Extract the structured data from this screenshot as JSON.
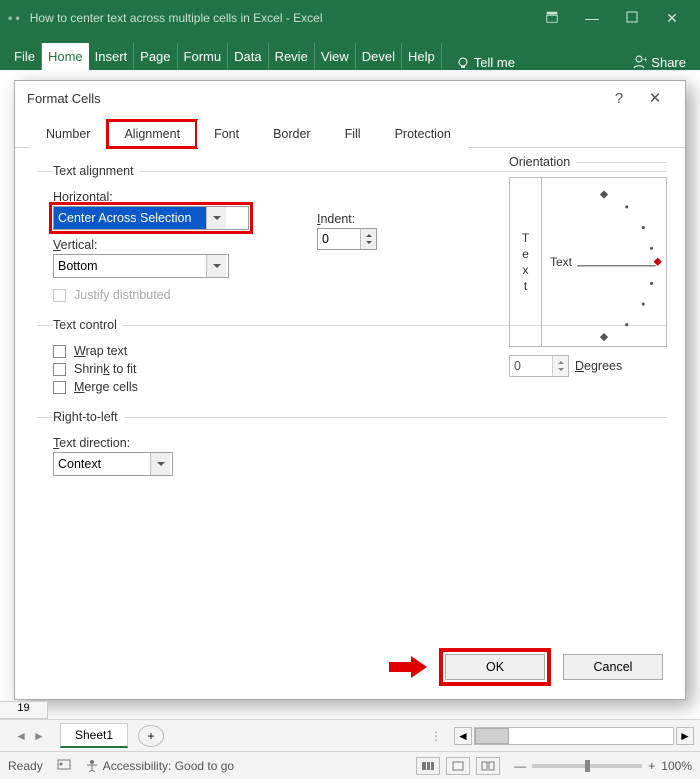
{
  "titlebar": {
    "title": "How to center text across multiple cells in Excel  -  Excel"
  },
  "ribbon": {
    "tabs": [
      "File",
      "Home",
      "Insert",
      "Page",
      "Formu",
      "Data",
      "Revie",
      "View",
      "Devel",
      "Help"
    ],
    "tellme": "Tell me",
    "share": "Share"
  },
  "dialog": {
    "title": "Format Cells",
    "tabs": {
      "number": "Number",
      "alignment": "Alignment",
      "font": "Font",
      "border": "Border",
      "fill": "Fill",
      "protection": "Protection"
    },
    "groups": {
      "text_alignment": "Text alignment",
      "text_control": "Text control",
      "rtl": "Right-to-left",
      "orientation": "Orientation"
    },
    "labels": {
      "horizontal": "Horizontal:",
      "vertical": "Vertical:",
      "indent": "Indent:",
      "justify": "Justify distributed",
      "wrap": "Wrap text",
      "shrink": "Shrink to fit",
      "merge": "Merge cells",
      "text_direction": "Text direction:",
      "degrees": "Degrees",
      "text": "Text"
    },
    "values": {
      "horizontal": "Center Across Selection",
      "vertical": "Bottom",
      "indent": "0",
      "text_direction": "Context",
      "degrees": "0",
      "orient_vertical": "T e x t"
    },
    "buttons": {
      "ok": "OK",
      "cancel": "Cancel"
    }
  },
  "sheet": {
    "rownum": "19",
    "tab": "Sheet1"
  },
  "status": {
    "ready": "Ready",
    "access": "Accessibility: Good to go",
    "zoom": "100%"
  }
}
